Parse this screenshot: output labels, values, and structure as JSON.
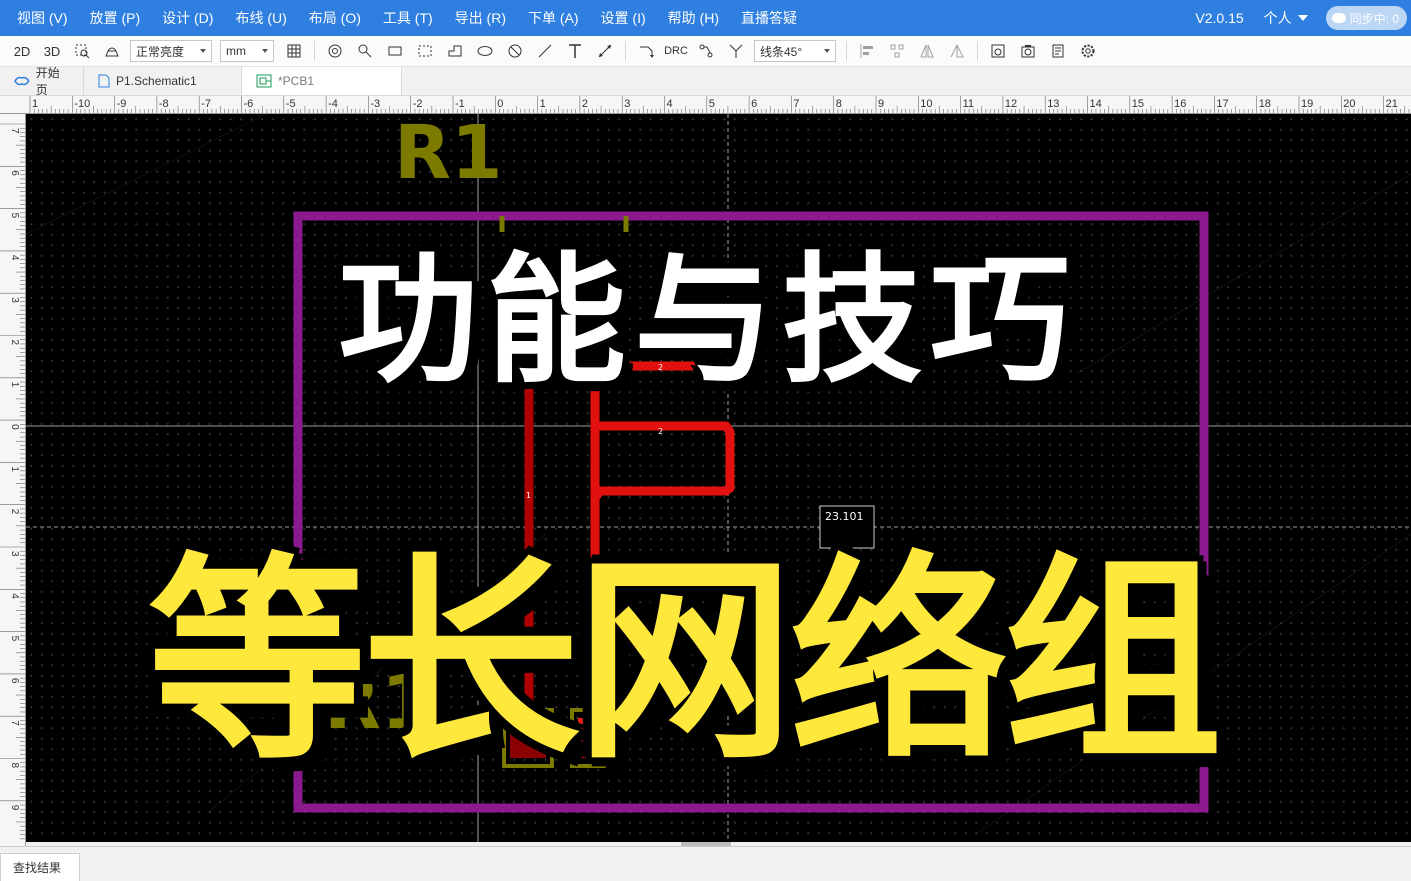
{
  "menu": {
    "items": [
      "视图 (V)",
      "放置 (P)",
      "设计 (D)",
      "布线 (U)",
      "布局 (O)",
      "工具 (T)",
      "导出 (R)",
      "下单 (A)",
      "设置 (I)",
      "帮助 (H)",
      "直播答疑"
    ],
    "version": "V2.0.15",
    "account": "个人",
    "sync_status": "同步中: 0"
  },
  "toolbar": {
    "view_2d": "2D",
    "view_3d": "3D",
    "brightness_select": "正常亮度",
    "unit_select": "mm",
    "drc_label": "DRC",
    "route_angle_select": "线条45°"
  },
  "tabs": [
    {
      "label": "开始页",
      "icon": "home-icon"
    },
    {
      "label": "P1.Schematic1",
      "icon": "document-icon"
    },
    {
      "label": "*PCB1",
      "icon": "pcb-icon"
    }
  ],
  "ruler": {
    "top_ticks": [
      "1",
      "-10",
      "-9",
      "-8",
      "-7",
      "-6",
      "-5",
      "-4",
      "-3",
      "-2",
      "-1",
      "0",
      "1",
      "2",
      "3",
      "4",
      "5",
      "6",
      "7",
      "8",
      "9",
      "10",
      "11",
      "12",
      "13",
      "14",
      "15",
      "16",
      "17",
      "18",
      "19",
      "20",
      "21"
    ],
    "left_ticks": [
      "7",
      "6",
      "5",
      "4",
      "3",
      "2",
      "1",
      "0",
      "1",
      "2",
      "3",
      "4",
      "5",
      "6",
      "7",
      "8",
      "9"
    ]
  },
  "pcb": {
    "designator_top": "R1",
    "designator_bottom": "R1",
    "pad_1": "1",
    "pad_2": "2",
    "net_label_a": "2",
    "net_label_b": "1",
    "length_readout": "23.101",
    "colors": {
      "board_outline": "#8a1a8e",
      "silkscreen": "#7d7a00",
      "track": "#e31010",
      "pad_1_fill": "#8b0000",
      "pad_2_fill": "#ff1a1a",
      "crosshair": "#d0d0d0"
    }
  },
  "overlay": {
    "top_text": "功能与技巧",
    "bottom_text": "等长网络组",
    "top_color": "#ffffff",
    "bottom_color": "#ffe83c"
  },
  "bottom": {
    "search_results_tab": "查找结果"
  }
}
